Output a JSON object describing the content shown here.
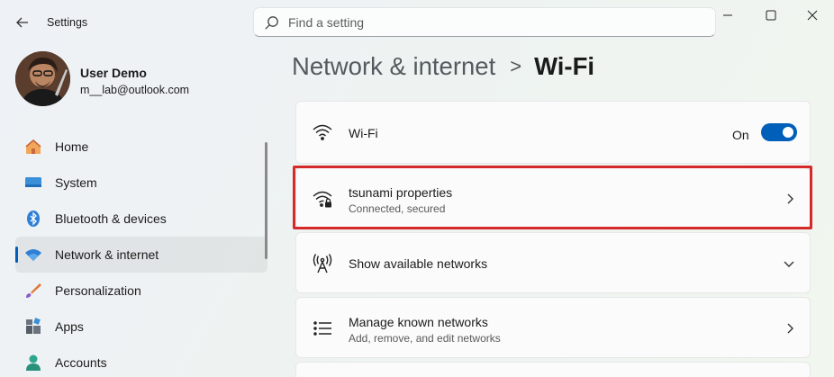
{
  "window": {
    "title": "Settings"
  },
  "search": {
    "placeholder": "Find a setting"
  },
  "user": {
    "name": "User Demo",
    "email": "m__lab@outlook.com"
  },
  "sidebar": {
    "items": [
      {
        "label": "Home",
        "icon": "home-icon"
      },
      {
        "label": "System",
        "icon": "system-icon"
      },
      {
        "label": "Bluetooth & devices",
        "icon": "bluetooth-icon"
      },
      {
        "label": "Network & internet",
        "icon": "wifi-icon",
        "active": true
      },
      {
        "label": "Personalization",
        "icon": "brush-icon"
      },
      {
        "label": "Apps",
        "icon": "apps-icon"
      },
      {
        "label": "Accounts",
        "icon": "accounts-icon"
      }
    ]
  },
  "breadcrumb": {
    "parent": "Network & internet",
    "separator": ">",
    "current": "Wi-Fi"
  },
  "main": {
    "wifi_row": {
      "title": "Wi-Fi",
      "toggle_state": "On",
      "toggle_on": true
    },
    "network_row": {
      "title": "tsunami properties",
      "subtitle": "Connected, secured"
    },
    "available_row": {
      "title": "Show available networks"
    },
    "known_row": {
      "title": "Manage known networks",
      "subtitle": "Add, remove, and edit networks"
    }
  },
  "colors": {
    "accent": "#005fb8",
    "highlight": "#d62a2a"
  }
}
